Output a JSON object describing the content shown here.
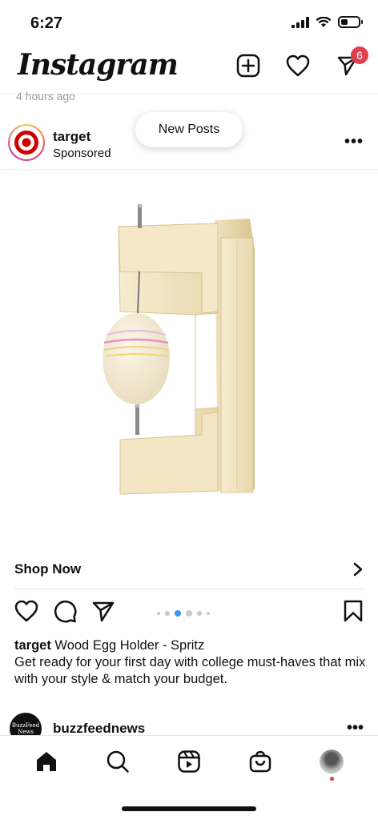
{
  "status_bar": {
    "time": "6:27"
  },
  "header": {
    "logo": "Instagram",
    "notification_count": "6"
  },
  "feed": {
    "previous_post_time": "4 hours ago",
    "new_posts_label": "New Posts"
  },
  "post": {
    "username": "target",
    "subtitle": "Sponsored",
    "more": "•••",
    "image_icon": "wood-egg-holder-image",
    "shop_now_label": "Shop Now",
    "carousel": {
      "count": 6,
      "active_index": 2
    },
    "caption_user": "target",
    "caption_title": " Wood Egg Holder - Spritz",
    "caption_body": "Get ready for your first day with college must-haves that mix with your style & match your budget."
  },
  "next_post": {
    "username": "buzzfeednews",
    "avatar_text": "BuzzFeed News",
    "more": "•••"
  },
  "tabs": [
    "home",
    "search",
    "reels",
    "shop",
    "profile"
  ],
  "colors": {
    "badge": "#e0404e",
    "target_red": "#cc0000",
    "carousel_active": "#3897f0"
  }
}
